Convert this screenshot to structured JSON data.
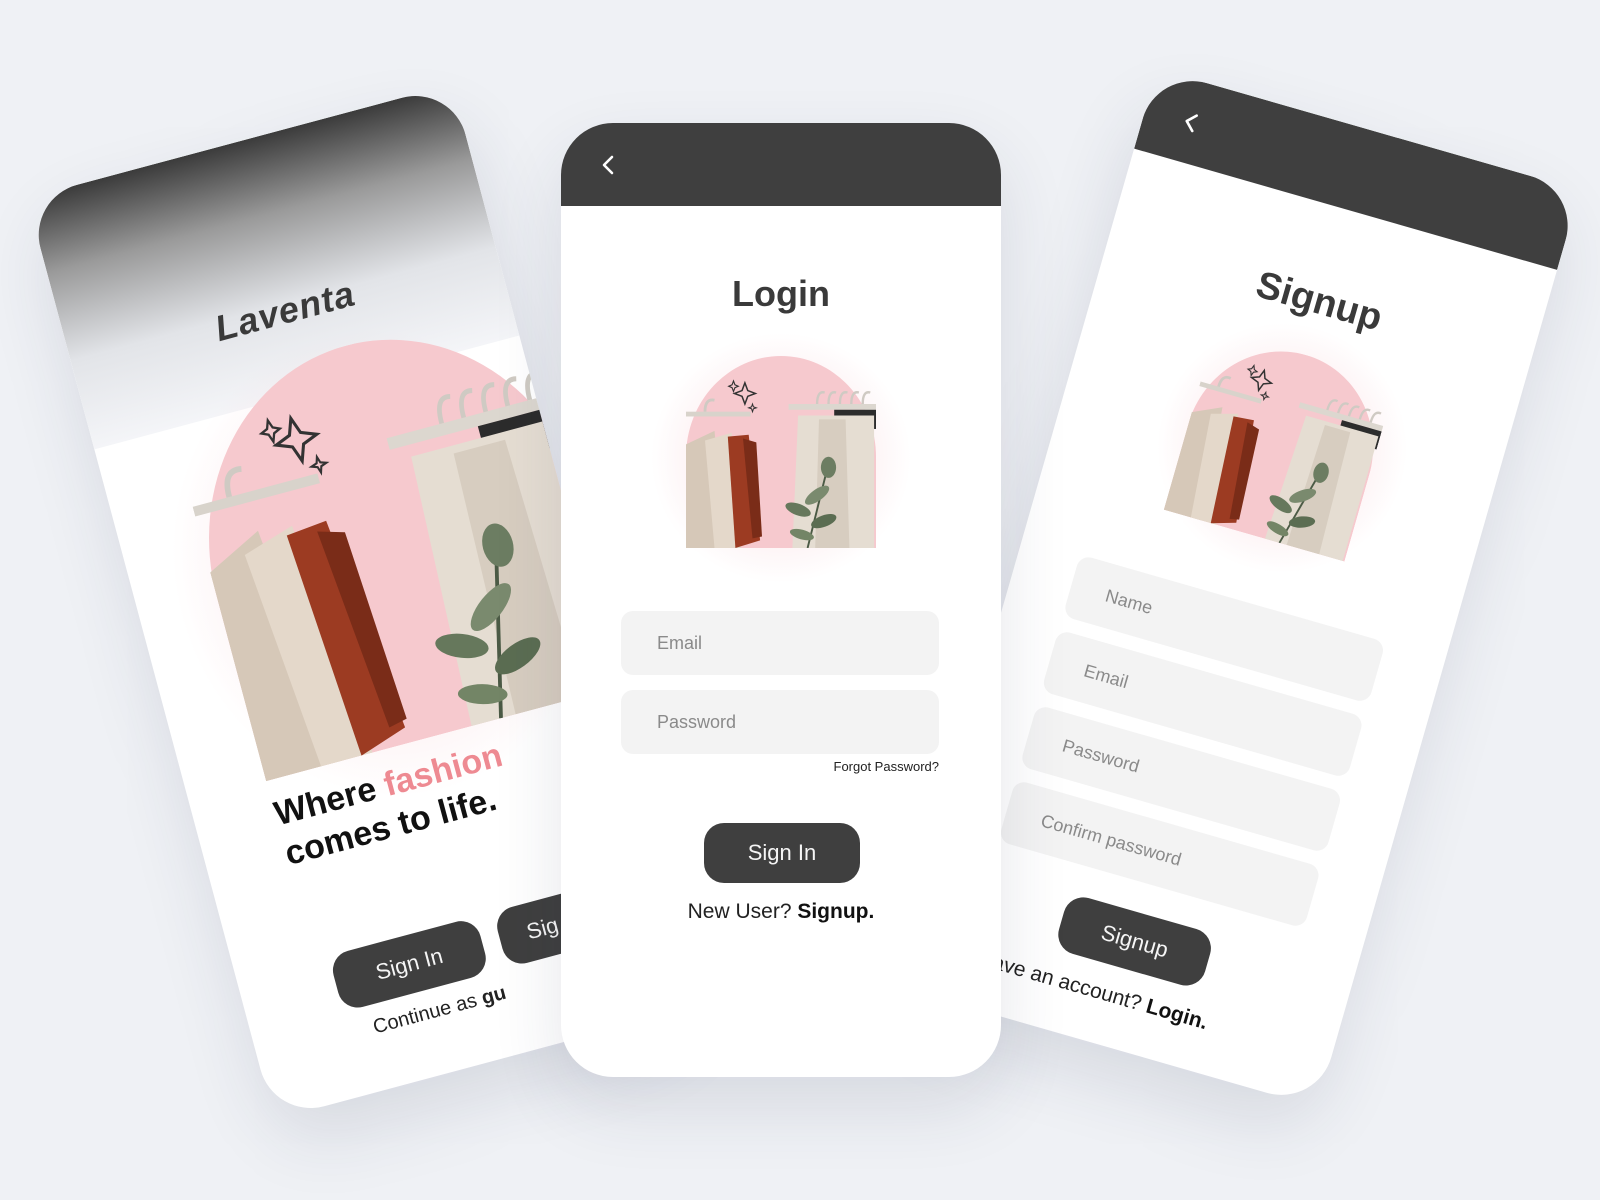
{
  "welcome": {
    "brand": "Laventa",
    "headline_part1": "Where ",
    "headline_accent": "fashion",
    "headline_part2": "comes to life.",
    "signin_label": "Sign In",
    "signup_label_partial": "Sig",
    "guest_prefix": "Continue as ",
    "guest_link_partial": "gu"
  },
  "login": {
    "title": "Login",
    "email_placeholder": "Email",
    "password_placeholder": "Password",
    "forgot_label": "Forgot Password?",
    "signin_label": "Sign In",
    "new_user_prefix": "New User? ",
    "signup_link": "Signup."
  },
  "signup": {
    "title": "Signup",
    "name_placeholder": "Name",
    "email_placeholder": "Email",
    "password_placeholder": "Password",
    "confirm_placeholder": "Confirm password",
    "signup_label": "Signup",
    "account_prefix_partial": "dy have an account? ",
    "login_link": "Login."
  },
  "colors": {
    "background": "#eff1f5",
    "dark": "#3f3f3f",
    "accent": "#ee8a92",
    "pink": "#f7c8cd",
    "field": "#f3f3f3"
  },
  "icons": {
    "back": "chevron-left-icon",
    "sparkle": "sparkle-icon"
  }
}
